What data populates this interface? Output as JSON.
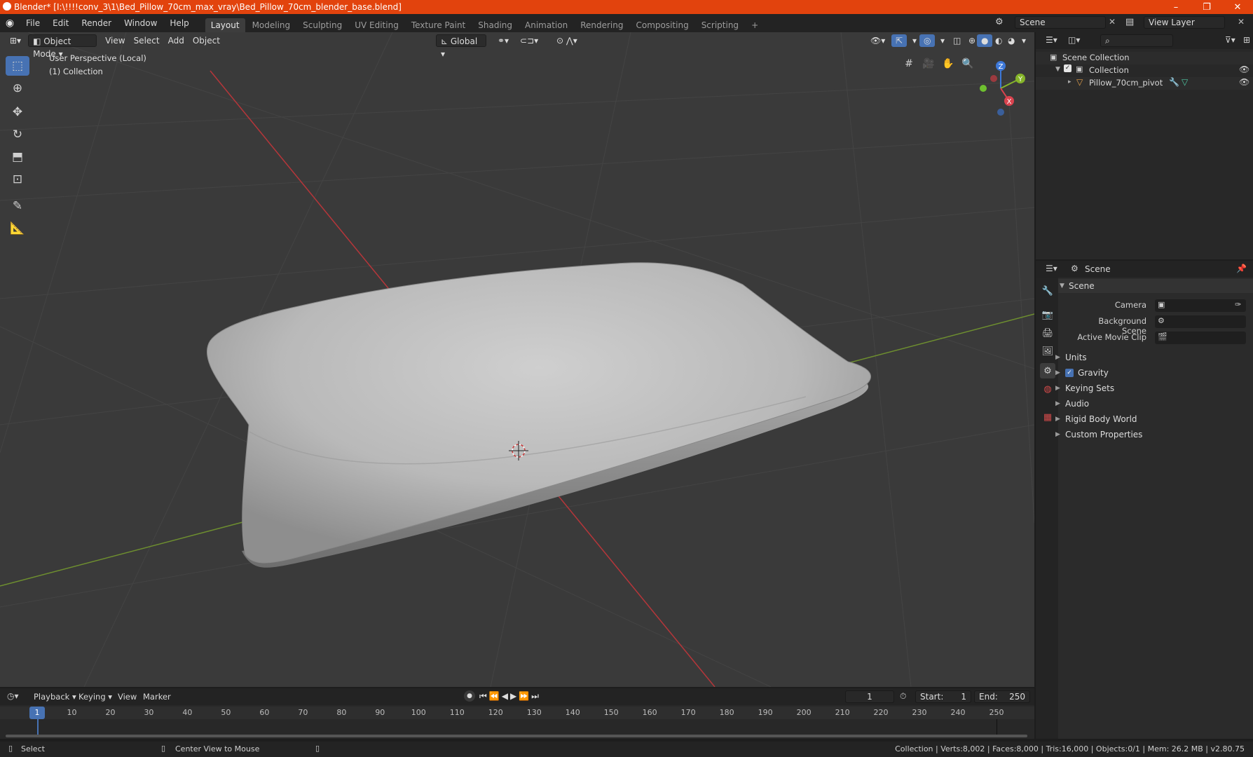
{
  "window": {
    "title": "Blender* [I:\\!!!!conv_3\\1\\Bed_Pillow_70cm_max_vray\\Bed_Pillow_70cm_blender_base.blend]",
    "minimize": "–",
    "restore": "❐",
    "close": "✕"
  },
  "menu": {
    "file": "File",
    "edit": "Edit",
    "render": "Render",
    "window": "Window",
    "help": "Help"
  },
  "workspaces": [
    {
      "label": "Layout",
      "active": true
    },
    {
      "label": "Modeling"
    },
    {
      "label": "Sculpting"
    },
    {
      "label": "UV Editing"
    },
    {
      "label": "Texture Paint"
    },
    {
      "label": "Shading"
    },
    {
      "label": "Animation"
    },
    {
      "label": "Rendering"
    },
    {
      "label": "Compositing"
    },
    {
      "label": "Scripting"
    }
  ],
  "add_workspace": "+",
  "scene_selector": "Scene",
  "view_layer": "View Layer",
  "viewport": {
    "mode": "Object Mode",
    "view": "View",
    "select": "Select",
    "add": "Add",
    "object": "Object",
    "orientation": "Global",
    "info_line1": "User Perspective (Local)",
    "info_line2": "(1) Collection",
    "gizmo": {
      "z": "Z",
      "y": "Y",
      "x": "X"
    }
  },
  "outliner": {
    "scene_collection": "Scene Collection",
    "collection": "Collection",
    "object": "Pillow_70cm_pivot"
  },
  "properties": {
    "header": "Scene",
    "panel": "Scene",
    "camera_label": "Camera",
    "background_scene_label": "Background Scene",
    "active_movie_clip_label": "Active Movie Clip",
    "sections": [
      "Units",
      "Gravity",
      "Keying Sets",
      "Audio",
      "Rigid Body World",
      "Custom Properties"
    ]
  },
  "timeline": {
    "playback": "Playback",
    "keying": "Keying",
    "view": "View",
    "marker": "Marker",
    "current_frame": "1",
    "start_label": "Start:",
    "start": "1",
    "end_label": "End:",
    "end": "250",
    "ruler": [
      "10",
      "20",
      "30",
      "40",
      "50",
      "60",
      "70",
      "80",
      "90",
      "100",
      "110",
      "120",
      "130",
      "140",
      "150",
      "160",
      "170",
      "180",
      "190",
      "200",
      "210",
      "220",
      "230",
      "240",
      "250"
    ],
    "playhead": "1"
  },
  "status": {
    "select": "Select",
    "center_view": "Center View to Mouse",
    "stats": "Collection | Verts:8,002 | Faces:8,000 | Tris:16,000 | Objects:0/1 | Mem: 26.2 MB | v2.80.75"
  }
}
